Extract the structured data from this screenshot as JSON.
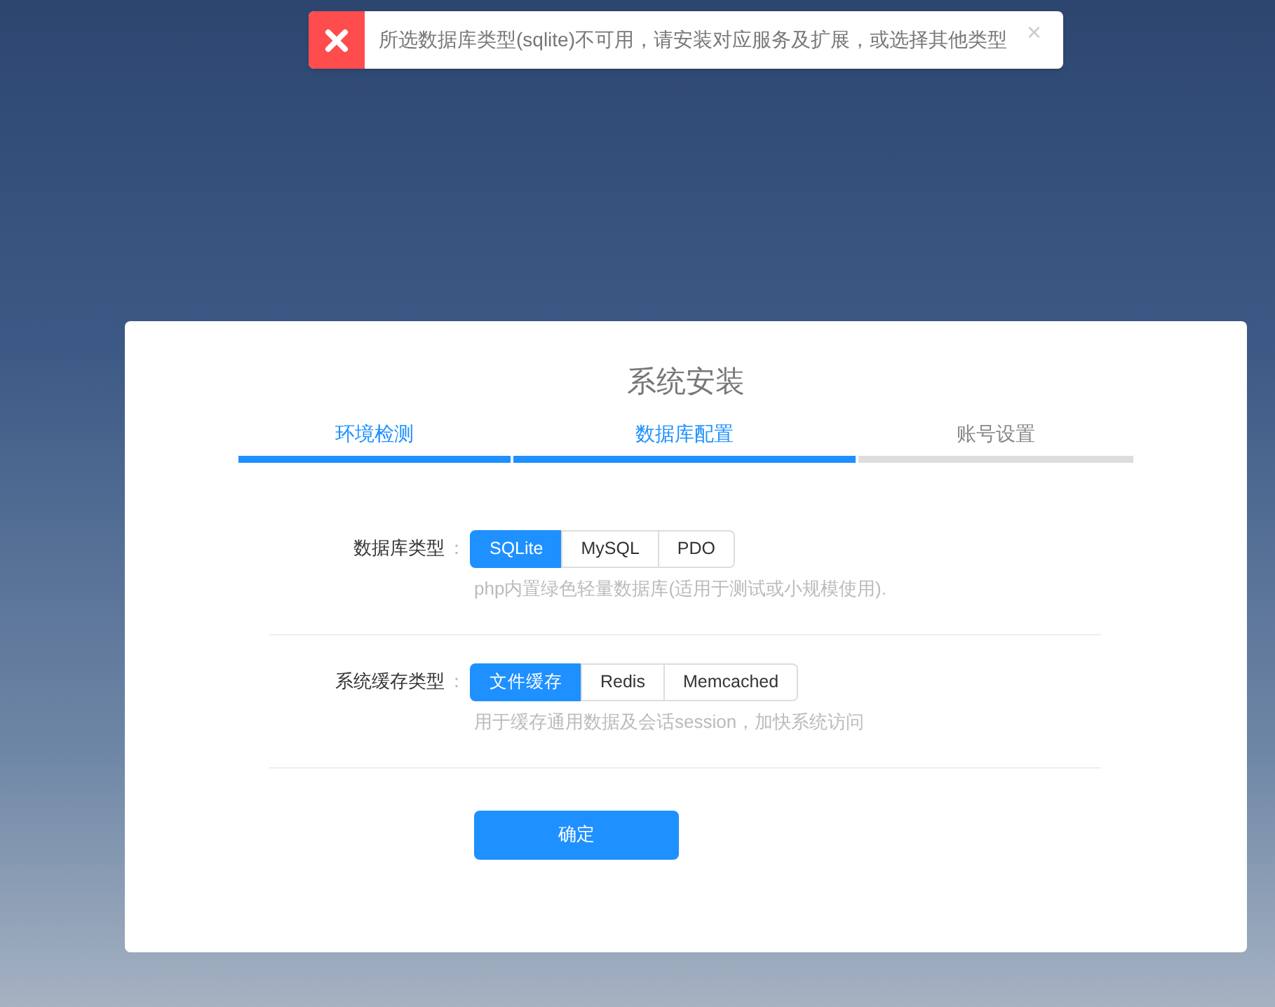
{
  "toast": {
    "kind": "error",
    "message": "所选数据库类型(sqlite)不可用，请安装对应服务及扩展，或选择其他类型",
    "close": "×"
  },
  "title": "系统安装",
  "steps": [
    {
      "label": "环境检测",
      "done": true
    },
    {
      "label": "数据库配置",
      "done": true
    },
    {
      "label": "账号设置",
      "done": false
    }
  ],
  "fields": [
    {
      "label": "数据库类型",
      "separator": "：",
      "options": [
        {
          "label": "SQLite",
          "selected": true
        },
        {
          "label": "MySQL",
          "selected": false
        },
        {
          "label": "PDO",
          "selected": false
        }
      ],
      "hint": "php内置绿色轻量数据库(适用于测试或小规模使用)."
    },
    {
      "label": "系统缓存类型",
      "separator": "：",
      "options": [
        {
          "label": "文件缓存",
          "selected": true
        },
        {
          "label": "Redis",
          "selected": false
        },
        {
          "label": "Memcached",
          "selected": false
        }
      ],
      "hint": "用于缓存通用数据及会话session，加快系统访问"
    }
  ],
  "submit": "确定"
}
